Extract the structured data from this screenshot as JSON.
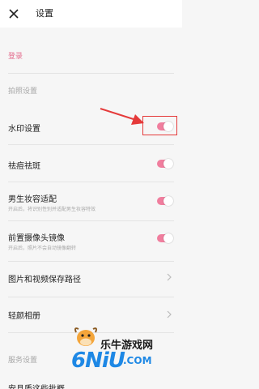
{
  "header": {
    "title": "设置"
  },
  "login": {
    "label": "登录"
  },
  "sections": {
    "photo": "拍照设置",
    "service": "服务设置"
  },
  "rows": {
    "watermark": {
      "label": "水印设置",
      "toggle_on": true
    },
    "acne": {
      "label": "祛痘祛斑",
      "toggle_on": true
    },
    "male_makeup": {
      "label": "男生妆容适配",
      "sub": "开启后，将识别性别并适配男生妆容特效",
      "toggle_on": true
    },
    "front_mirror": {
      "label": "前置摄像头镜像",
      "sub": "开启后，照片不会自动镜像翻转",
      "toggle_on": true
    },
    "save_path": {
      "label": "图片和视频保存路径"
    },
    "album": {
      "label": "轻颜相册"
    },
    "bottom": {
      "label": "安县质这些批概"
    }
  },
  "watermark_overlay": {
    "title": "乐牛游戏网",
    "logo": "6NiU",
    "domain": ".COM"
  },
  "colors": {
    "accent": "#f07e9e",
    "login_text": "#e46d8e",
    "annotation_red": "#e53a3a",
    "watermark_blue": "#1e88e5"
  },
  "icons": {
    "close": "close-icon",
    "chevron": "chevron-right-icon",
    "arrow": "red-arrow-annotation"
  }
}
